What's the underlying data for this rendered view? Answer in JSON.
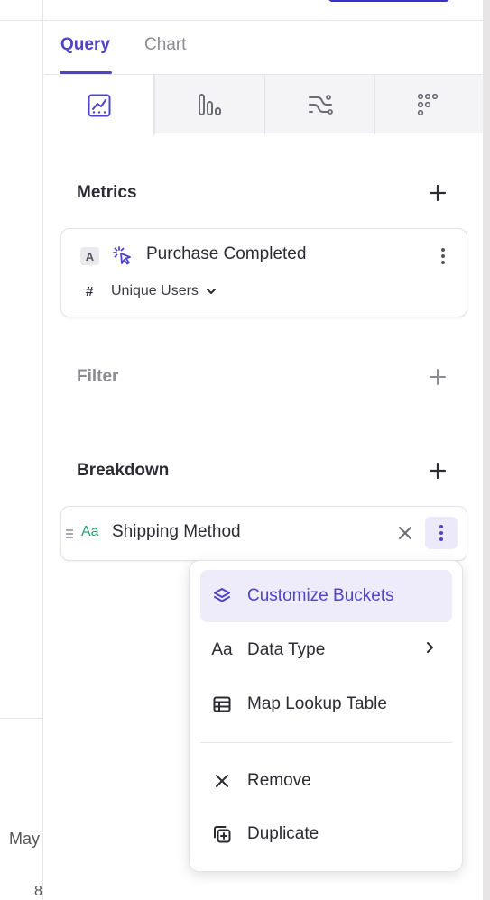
{
  "background_left": {
    "month_label": "May",
    "bottom_number": "8"
  },
  "tabs": [
    {
      "label": "Query",
      "active": true
    },
    {
      "label": "Chart",
      "active": false
    }
  ],
  "viz_types": [
    {
      "icon": "line-chart-icon",
      "active": true
    },
    {
      "icon": "bar-chart-icon",
      "active": false
    },
    {
      "icon": "flow-icon",
      "active": false
    },
    {
      "icon": "dot-grid-icon",
      "active": false
    }
  ],
  "metrics": {
    "title": "Metrics",
    "items": [
      {
        "letter": "A",
        "event": "Purchase Completed",
        "measure_symbol": "#",
        "measure": "Unique Users"
      }
    ]
  },
  "filter": {
    "title": "Filter"
  },
  "breakdown": {
    "title": "Breakdown",
    "items": [
      {
        "type_badge": "Aa",
        "property": "Shipping Method"
      }
    ]
  },
  "context_menu": {
    "items": [
      {
        "label": "Customize Buckets",
        "icon": "layers-icon",
        "active": true
      },
      {
        "label": "Data Type",
        "icon": "text-type-icon",
        "has_submenu": true
      },
      {
        "label": "Map Lookup Table",
        "icon": "table-icon"
      },
      {
        "label": "Remove",
        "icon": "close-icon"
      },
      {
        "label": "Duplicate",
        "icon": "duplicate-icon"
      }
    ]
  },
  "colors": {
    "accent": "#4f44c9",
    "accent_light": "#eeebfb",
    "text": "#2b2b33",
    "muted": "#8b8b95",
    "badge_green": "#2e9b6e"
  }
}
